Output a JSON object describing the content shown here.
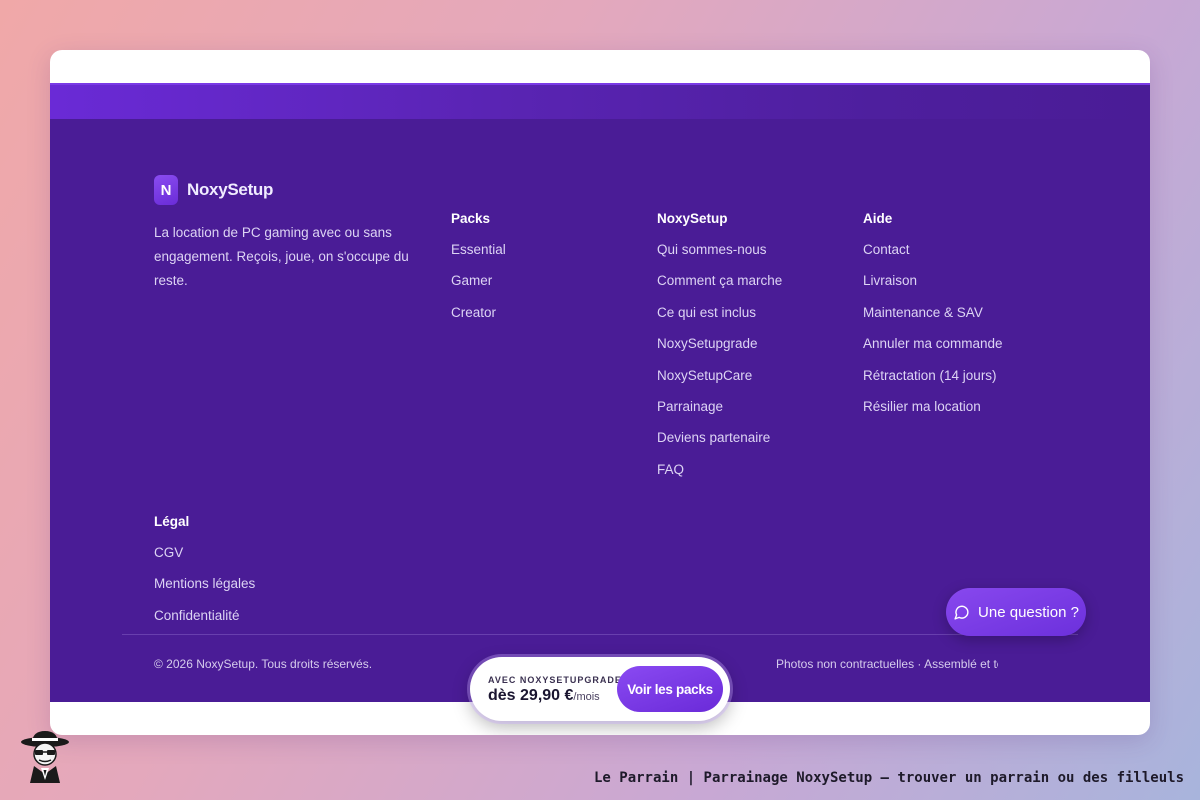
{
  "brand": {
    "logo_letter": "N",
    "name": "NoxySetup",
    "description": "La location de PC gaming avec ou sans engagement. Reçois, joue, on s'occupe du reste."
  },
  "columns": {
    "packs": {
      "title": "Packs",
      "items": [
        "Essential",
        "Gamer",
        "Creator"
      ]
    },
    "noxysetup": {
      "title": "NoxySetup",
      "items": [
        "Qui sommes-nous",
        "Comment ça marche",
        "Ce qui est inclus",
        "NoxySetupgrade",
        "NoxySetupCare",
        "Parrainage",
        "Deviens partenaire",
        "FAQ"
      ]
    },
    "aide": {
      "title": "Aide",
      "items": [
        "Contact",
        "Livraison",
        "Maintenance & SAV",
        "Annuler ma commande",
        "Rétractation (14 jours)",
        "Résilier ma location"
      ]
    },
    "legal": {
      "title": "Légal",
      "items": [
        "CGV",
        "Mentions légales",
        "Confidentialité"
      ]
    }
  },
  "bottom": {
    "copyright": "© 2026 NoxySetup. Tous droits réservés.",
    "note": "Photos non contractuelles · Assemblé et testé"
  },
  "promo": {
    "label": "AVEC NOXYSETUPGRADE",
    "price_prefix": "dès 29,90 €",
    "price_unit": "/mois",
    "button": "Voir les packs"
  },
  "chat": {
    "label": "Une question ?",
    "icon": "chat-bubble-icon"
  },
  "caption": "Le Parrain | Parrainage NoxySetup — trouver un parrain ou des filleuls",
  "colors": {
    "footer_bg": "#4a1c96",
    "accent": "#7a3ae6",
    "button": "#6a2ad8"
  }
}
